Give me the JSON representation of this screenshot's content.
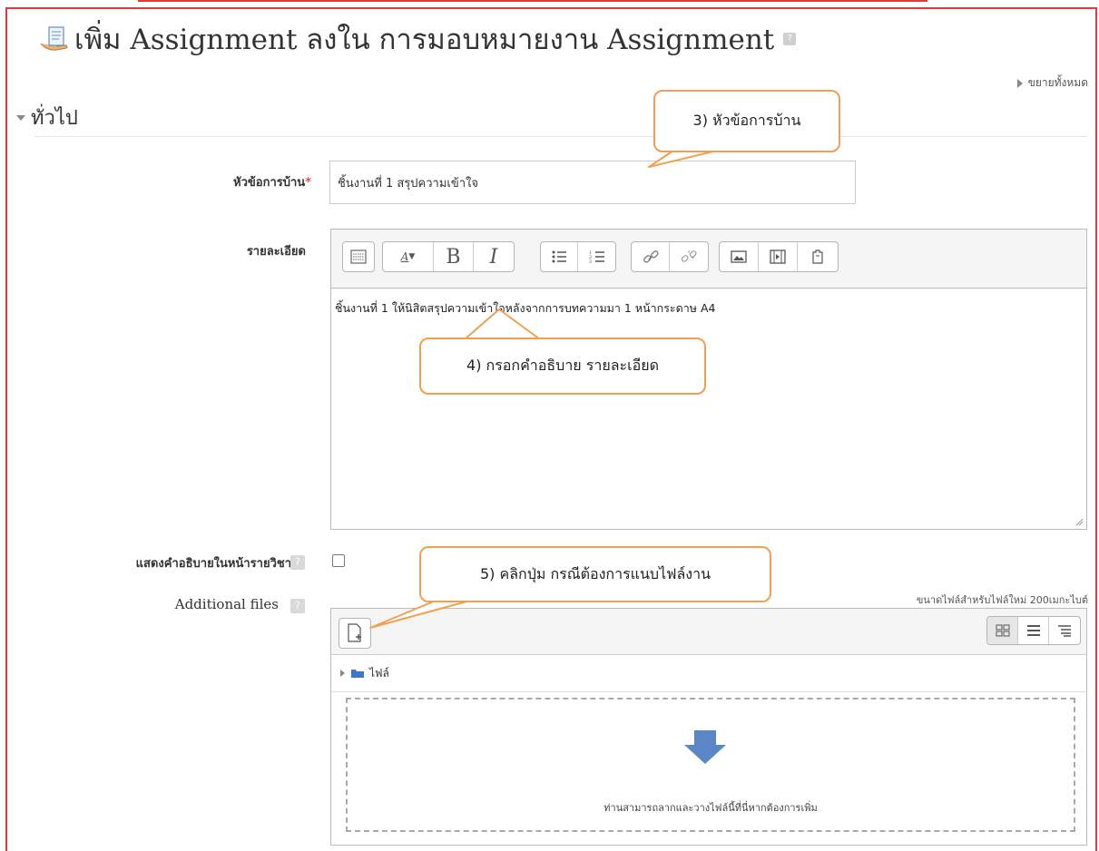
{
  "header": {
    "title": "เพิ่ม Assignment ลงใน การมอบหมายงาน Assignment",
    "help_symbol": "?",
    "expand_all": "ขยายทั้งหมด"
  },
  "section": {
    "title": "ทั่วไป"
  },
  "form": {
    "name_label": "หัวข้อการบ้าน",
    "required_mark": "*",
    "name_value": "ชิ้นงานที่ 1 สรุปความเข้าใจ",
    "description_label": "รายละเอียด",
    "description_text": "ชิ้นงานที่ 1 ให้นิสิตสรุปความเข้าใจหลังจากการบทความมา 1 หน้ากระดาษ A4",
    "show_description_label": "แสดงคำอธิบายในหน้ารายวิชา",
    "show_description_checked": false,
    "files_label": "Additional files",
    "max_size": "ขนาดไฟล์สำหรับไฟล์ใหม่ 200เมกะไบต์",
    "folder_label": "ไฟล์",
    "drop_text": "ท่านสามารถลากและวางไฟล์นี้ที่นี่หากต้องการเพิ่ม"
  },
  "toolbar": {
    "bold": "B",
    "italic": "I",
    "font_size": "A",
    "icons": [
      "toolbar-toggle-icon",
      "font-size-icon",
      "bold-icon",
      "italic-icon",
      "unordered-list-icon",
      "ordered-list-icon",
      "link-icon",
      "unlink-icon",
      "image-icon",
      "media-icon",
      "manage-files-icon"
    ]
  },
  "callouts": {
    "c3": "3) หัวข้อการบ้าน",
    "c4": "4)  กรอกคำอธิบาย รายละเอียด",
    "c5": "5)  คลิกปุ่ม กรณีต้องการแนบไฟล์งาน"
  },
  "colors": {
    "frame": "#e03a3a",
    "callout_border": "#f0a050",
    "required": "#d9534f",
    "drop_arrow": "#5b87c9"
  }
}
